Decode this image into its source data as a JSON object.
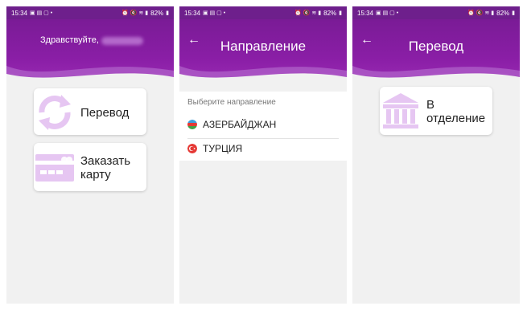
{
  "status_bar": {
    "time": "15:34",
    "battery": "82%"
  },
  "colors": {
    "primary": "#7a1b96",
    "icon_tint": "#e6c6f2",
    "background": "#f1f1f1"
  },
  "screen1": {
    "greeting": "Здравствуйте,",
    "options": [
      {
        "label": "Перевод",
        "icon": "refresh-arrows-icon"
      },
      {
        "label_line1": "Заказать",
        "label_line2": "карту",
        "icon": "card-icon"
      }
    ]
  },
  "screen2": {
    "title": "Направление",
    "hint": "Выберите направление",
    "destinations": [
      {
        "label": "АЗЕРБАЙДЖАН",
        "icon": "azerbaijan-flag-icon"
      },
      {
        "label": "ТУРЦИЯ",
        "icon": "turkey-flag-icon"
      }
    ]
  },
  "screen3": {
    "title": "Перевод",
    "option": {
      "label_line1": "В",
      "label_line2": "отделение",
      "icon": "bank-icon"
    }
  }
}
